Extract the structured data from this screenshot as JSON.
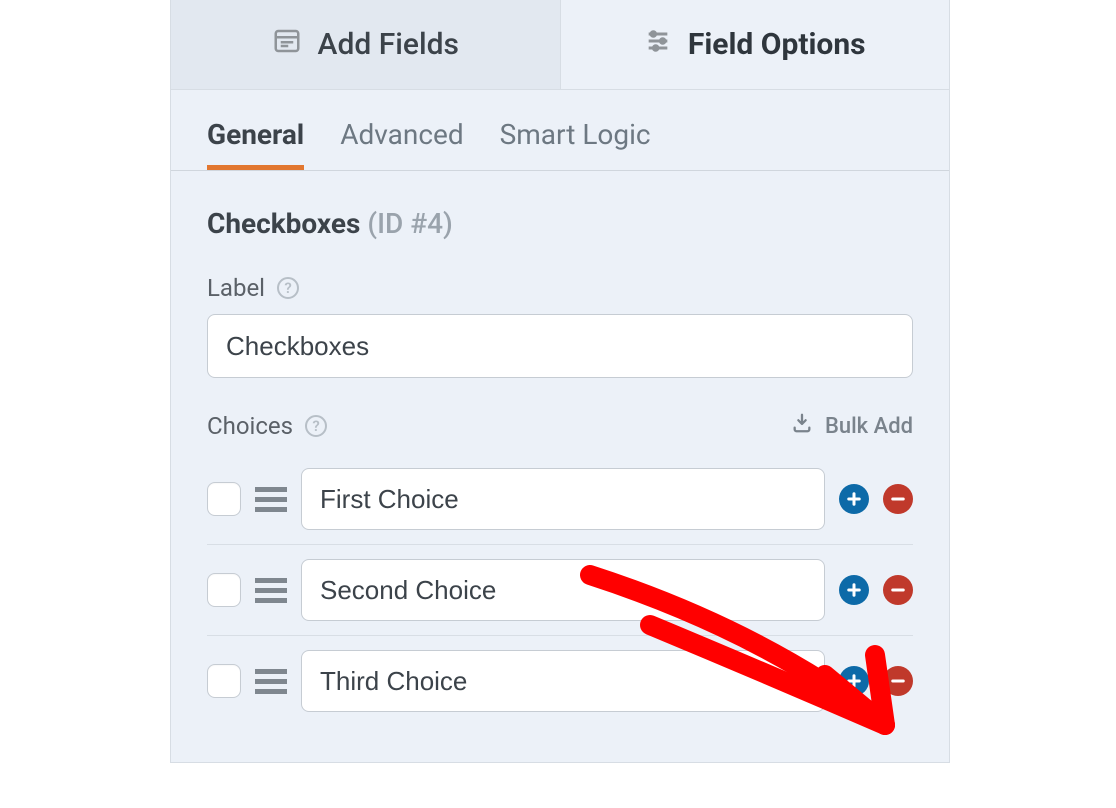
{
  "topTabs": {
    "addFields": "Add Fields",
    "fieldOptions": "Field Options"
  },
  "subTabs": {
    "general": "General",
    "advanced": "Advanced",
    "smartLogic": "Smart Logic"
  },
  "field": {
    "type": "Checkboxes",
    "idLabel": "(ID #4)"
  },
  "labels": {
    "label": "Label",
    "choices": "Choices",
    "bulkAdd": "Bulk Add"
  },
  "inputs": {
    "labelValue": "Checkboxes"
  },
  "choices": [
    {
      "value": "First Choice"
    },
    {
      "value": "Second Choice"
    },
    {
      "value": "Third Choice"
    }
  ]
}
